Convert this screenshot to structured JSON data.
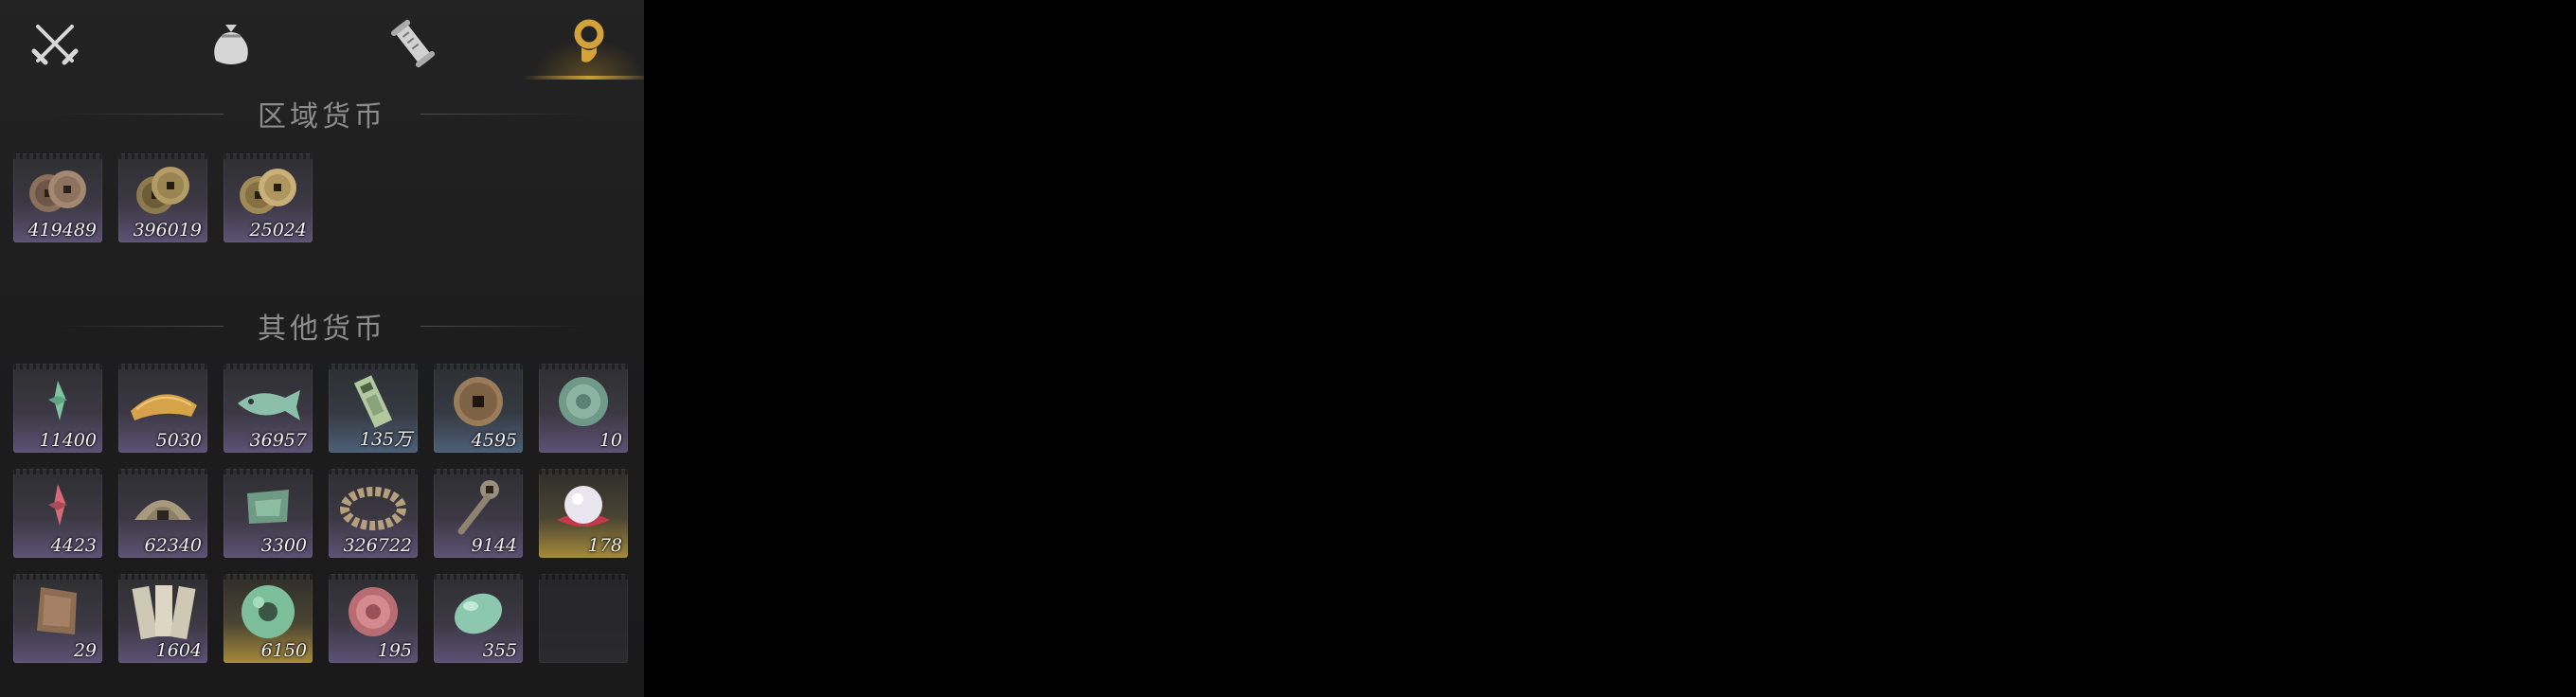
{
  "tabs": [
    {
      "name": "weapons-tab",
      "icon": "crossed-swords-icon",
      "active": false
    },
    {
      "name": "items-tab",
      "icon": "pouch-icon",
      "active": false
    },
    {
      "name": "scrolls-tab",
      "icon": "scroll-icon",
      "active": false
    },
    {
      "name": "currency-tab",
      "icon": "currency-icon",
      "active": true
    }
  ],
  "sections": {
    "regional": {
      "title": "区域货币"
    },
    "other": {
      "title": "其他货币"
    }
  },
  "regional_items": [
    {
      "icon": "copper-coins-icon",
      "qty": "419489",
      "rarity": "purple"
    },
    {
      "icon": "bronze-coins-icon",
      "qty": "396019",
      "rarity": "purple"
    },
    {
      "icon": "gold-coins-icon",
      "qty": "25024",
      "rarity": "purple"
    }
  ],
  "other_items": [
    {
      "icon": "jade-shard-icon",
      "qty": "11400",
      "rarity": "purple"
    },
    {
      "icon": "grain-pile-icon",
      "qty": "5030",
      "rarity": "purple"
    },
    {
      "icon": "jade-fish-icon",
      "qty": "36957",
      "rarity": "purple"
    },
    {
      "icon": "paper-note-icon",
      "qty": "135万",
      "rarity": "blue"
    },
    {
      "icon": "copper-coin-icon",
      "qty": "4595",
      "rarity": "blue"
    },
    {
      "icon": "jade-disc-icon",
      "qty": "10",
      "rarity": "purple"
    },
    {
      "icon": "red-shard-icon",
      "qty": "4423",
      "rarity": "purple"
    },
    {
      "icon": "silver-ingot-icon",
      "qty": "62340",
      "rarity": "purple"
    },
    {
      "icon": "jade-token-icon",
      "qty": "3300",
      "rarity": "purple"
    },
    {
      "icon": "coin-string-icon",
      "qty": "326722",
      "rarity": "purple"
    },
    {
      "icon": "coin-sword-icon",
      "qty": "9144",
      "rarity": "purple"
    },
    {
      "icon": "pearl-icon",
      "qty": "178",
      "rarity": "gold"
    },
    {
      "icon": "bronze-plaque-icon",
      "qty": "29",
      "rarity": "purple"
    },
    {
      "icon": "bamboo-slips-icon",
      "qty": "1604",
      "rarity": "purple"
    },
    {
      "icon": "jade-bi-icon",
      "qty": "6150",
      "rarity": "gold"
    },
    {
      "icon": "red-medallion-icon",
      "qty": "195",
      "rarity": "purple"
    },
    {
      "icon": "jade-pebble-icon",
      "qty": "355",
      "rarity": "purple"
    }
  ],
  "colors": {
    "accent": "#d4a23a",
    "rarity_purple": "#5c5275",
    "rarity_blue": "#4d5f78",
    "rarity_gold": "#a58a3a"
  }
}
